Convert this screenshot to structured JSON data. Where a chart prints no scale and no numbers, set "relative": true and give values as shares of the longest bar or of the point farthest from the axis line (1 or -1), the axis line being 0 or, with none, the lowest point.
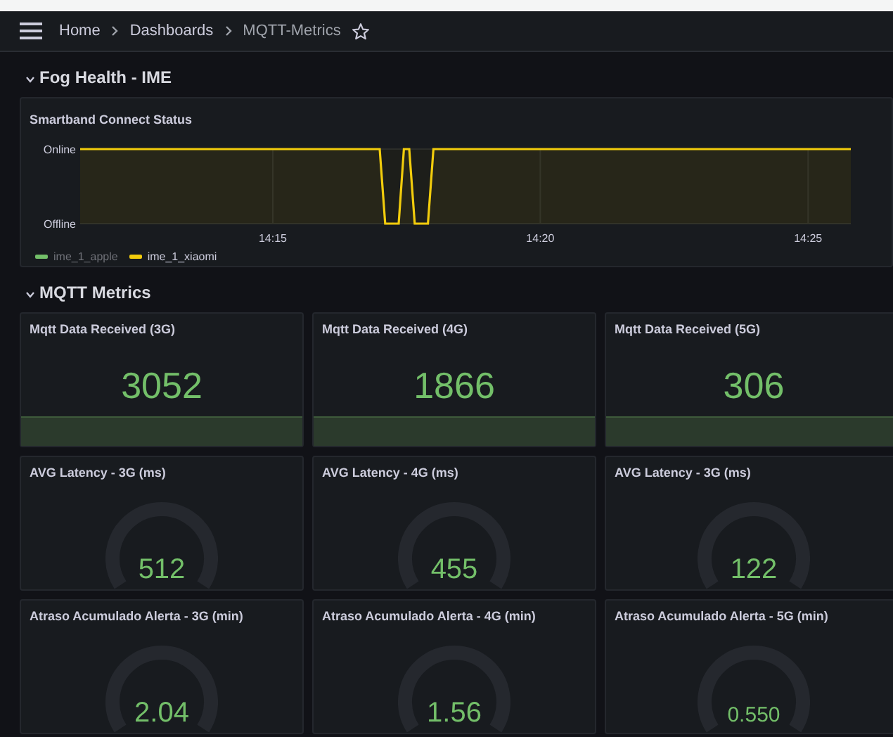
{
  "breadcrumb": [
    {
      "label": "Home",
      "current": false
    },
    {
      "label": "Dashboards",
      "current": false
    },
    {
      "label": "MQTT-Metrics",
      "current": true
    }
  ],
  "sections": [
    {
      "title": "Fog Health - IME",
      "expanded": true,
      "panels": [
        {
          "kind": "timeseries",
          "title": "Smartband Connect Status",
          "state_labels": [
            "Online",
            "Offline"
          ],
          "chart_data": {
            "type": "line",
            "relative": true,
            "grid": true,
            "xlim": [
              14.19,
              14.43
            ],
            "xticks": [
              {
                "value": 14.25,
                "label": "14:15"
              },
              {
                "value": 14.3333,
                "label": "14:20"
              },
              {
                "value": 14.4167,
                "label": "14:25"
              }
            ],
            "x": [
              14.19,
              14.2833,
              14.285,
              14.2892,
              14.2908,
              14.2925,
              14.2942,
              14.2983,
              14.3,
              14.43
            ],
            "series": [
              {
                "name": "ime_1_apple",
                "color": "#73bf69",
                "values": [
                  null,
                  null,
                  null,
                  null,
                  null,
                  null,
                  null,
                  null,
                  null,
                  null
                ]
              },
              {
                "name": "ime_1_xiaomi",
                "color": "#f2cc0c",
                "values": [
                  1,
                  1,
                  0,
                  0,
                  1,
                  1,
                  0,
                  0,
                  1,
                  1
                ]
              }
            ]
          }
        }
      ]
    },
    {
      "title": "MQTT Metrics",
      "expanded": true,
      "panels": [
        {
          "kind": "stat",
          "title": "Mqtt Data Received (3G)",
          "value": "3052"
        },
        {
          "kind": "stat",
          "title": "Mqtt Data Received (4G)",
          "value": "1866"
        },
        {
          "kind": "stat",
          "title": "Mqtt Data Received (5G)",
          "value": "306"
        },
        {
          "kind": "gauge",
          "title": "AVG Latency - 3G (ms)",
          "value": "512"
        },
        {
          "kind": "gauge",
          "title": "AVG Latency - 4G (ms)",
          "value": "455"
        },
        {
          "kind": "gauge",
          "title": "AVG Latency - 3G (ms)",
          "value": "122"
        },
        {
          "kind": "gauge",
          "title": "Atraso Acumulado Alerta - 3G (min)",
          "value": "2.04"
        },
        {
          "kind": "gauge",
          "title": "Atraso Acumulado Alerta - 4G (min)",
          "value": "1.56"
        },
        {
          "kind": "gauge",
          "title": "Atraso Acumulado Alerta - 5G (min)",
          "value": "0.550"
        }
      ]
    }
  ]
}
